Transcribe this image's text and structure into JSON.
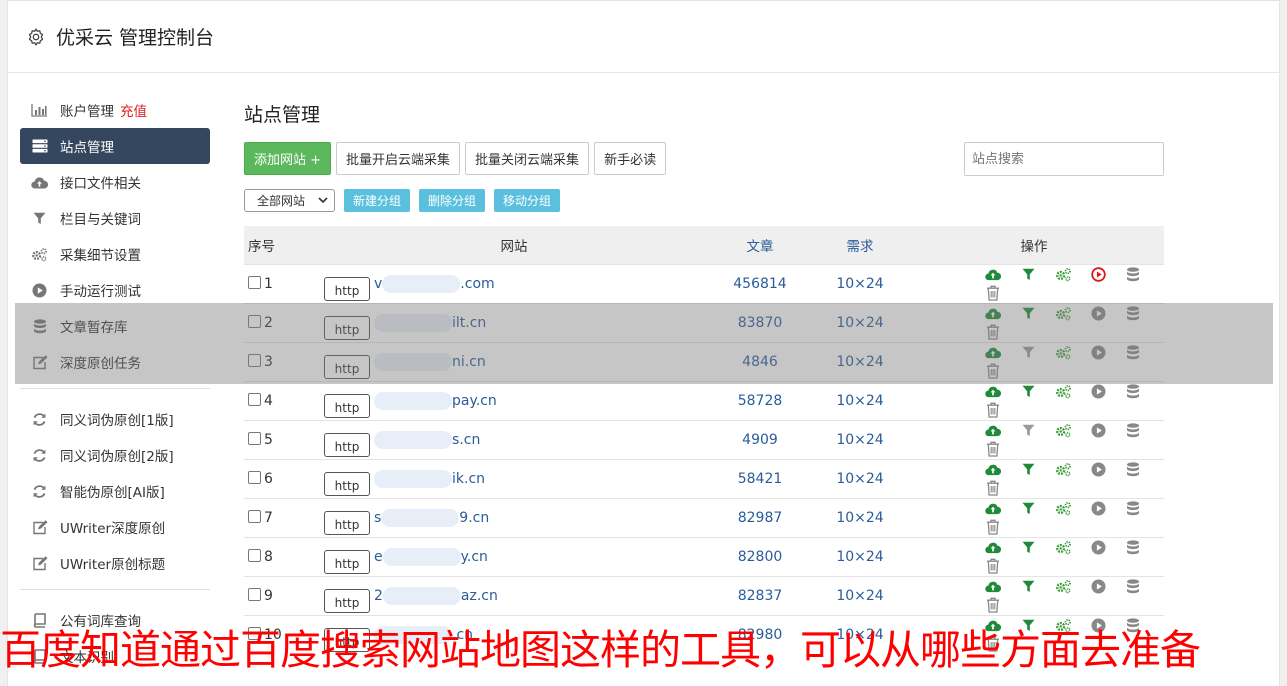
{
  "header": {
    "title": "优采云 管理控制台",
    "icon": "gear-icon"
  },
  "sidebar": {
    "groups": [
      [
        {
          "label": "账户管理",
          "badge": "充值",
          "icon": "bar-chart-icon",
          "active": false
        },
        {
          "label": "站点管理",
          "icon": "server-icon",
          "active": true
        },
        {
          "label": "接口文件相关",
          "icon": "cloud-upload-icon",
          "active": false
        },
        {
          "label": "栏目与关键词",
          "icon": "filter-icon",
          "active": false
        },
        {
          "label": "采集细节设置",
          "icon": "cogs-icon",
          "active": false
        },
        {
          "label": "手动运行测试",
          "icon": "play-circle-icon",
          "active": false
        },
        {
          "label": "文章暂存库",
          "icon": "database-icon",
          "active": false
        },
        {
          "label": "深度原创任务",
          "icon": "edit-icon",
          "active": false
        }
      ],
      [
        {
          "label": "同义词伪原创[1版]",
          "icon": "refresh-icon",
          "active": false
        },
        {
          "label": "同义词伪原创[2版]",
          "icon": "refresh-icon",
          "active": false
        },
        {
          "label": "智能伪原创[AI版]",
          "icon": "refresh-icon",
          "active": false
        },
        {
          "label": "UWriter深度原创",
          "icon": "edit-icon",
          "active": false
        },
        {
          "label": "UWriter原创标题",
          "icon": "edit-icon",
          "active": false
        }
      ],
      [
        {
          "label": "公有词库查询",
          "icon": "book-icon",
          "active": false
        },
        {
          "label": "文本识别",
          "icon": "book-icon",
          "active": false
        }
      ]
    ]
  },
  "main": {
    "title": "站点管理",
    "buttons": {
      "add": "添加网站 +",
      "batch_on": "批量开启云端采集",
      "batch_off": "批量关闭云端采集",
      "guide": "新手必读"
    },
    "search_placeholder": "站点搜索",
    "group_select": "全部网站",
    "group_buttons": {
      "new": "新建分组",
      "delete": "删除分组",
      "move": "移动分组"
    },
    "table": {
      "headers": {
        "no": "序号",
        "site": "网站",
        "articles": "文章",
        "demand": "需求",
        "ops": "操作"
      },
      "http_label": "http",
      "rows": [
        {
          "no": "1",
          "domain_prefix": "v",
          "domain": ".com",
          "articles": "456814",
          "demand": "10×24",
          "filter_on": true,
          "running": true
        },
        {
          "no": "2",
          "domain_prefix": "",
          "domain": "ilt.cn",
          "articles": "83870",
          "demand": "10×24",
          "filter_on": true,
          "running": false
        },
        {
          "no": "3",
          "domain_prefix": "",
          "domain": "ni.cn",
          "articles": "4846",
          "demand": "10×24",
          "filter_on": false,
          "running": false
        },
        {
          "no": "4",
          "domain_prefix": "",
          "domain": "pay.cn",
          "articles": "58728",
          "demand": "10×24",
          "filter_on": true,
          "running": false
        },
        {
          "no": "5",
          "domain_prefix": "",
          "domain": "s.cn",
          "articles": "4909",
          "demand": "10×24",
          "filter_on": false,
          "running": false
        },
        {
          "no": "6",
          "domain_prefix": "",
          "domain": "ik.cn",
          "articles": "58421",
          "demand": "10×24",
          "filter_on": true,
          "running": false
        },
        {
          "no": "7",
          "domain_prefix": "s",
          "domain": "9.cn",
          "articles": "82987",
          "demand": "10×24",
          "filter_on": true,
          "running": false
        },
        {
          "no": "8",
          "domain_prefix": "e",
          "domain": "y.cn",
          "articles": "82800",
          "demand": "10×24",
          "filter_on": true,
          "running": false
        },
        {
          "no": "9",
          "domain_prefix": "2",
          "domain": "az.cn",
          "articles": "82837",
          "demand": "10×24",
          "filter_on": true,
          "running": false
        },
        {
          "no": "10",
          "domain_prefix": "",
          "domain": ".cn",
          "articles": "82980",
          "demand": "10×24",
          "filter_on": true,
          "running": false
        }
      ]
    }
  },
  "caption": "百度知道通过百度搜索网站地图这样的工具，可以从哪些方面去准备",
  "colors": {
    "active_bg": "#35475f",
    "green": "#5cb85c",
    "info": "#5bc0de",
    "link": "#2a5c9a",
    "caption": "#ff0000"
  }
}
